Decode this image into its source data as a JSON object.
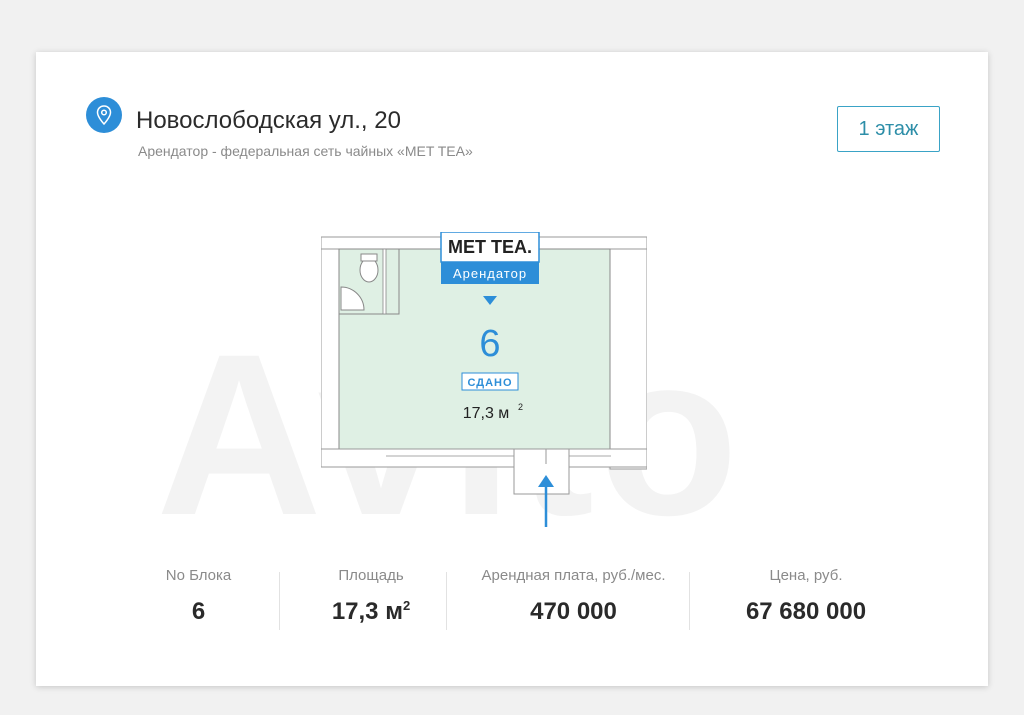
{
  "header": {
    "address": "Новослободская ул., 20",
    "tenant_note": "Арендатор - федеральная сеть чайных «MET TEA»",
    "floor_button": "1 этаж",
    "location_icon": "map-pin-icon",
    "accent_color": "#2d8ed8"
  },
  "plan": {
    "brand": "MET TEA.",
    "tenant_tag": "Арендатор",
    "block_number": "6",
    "status": "СДАНО",
    "area": "17,3 м",
    "area_exp": "2",
    "room_color": "#dff0e4"
  },
  "watermark": "Avito",
  "stats": {
    "block_label": "No Блока",
    "block_value": "6",
    "area_label": "Площадь",
    "area_value": "17,3 м",
    "area_exp": "2",
    "rent_label": "Арендная плата, руб./мес.",
    "rent_value": "470 000",
    "price_label": "Цена, руб.",
    "price_value": "67 680 000"
  }
}
